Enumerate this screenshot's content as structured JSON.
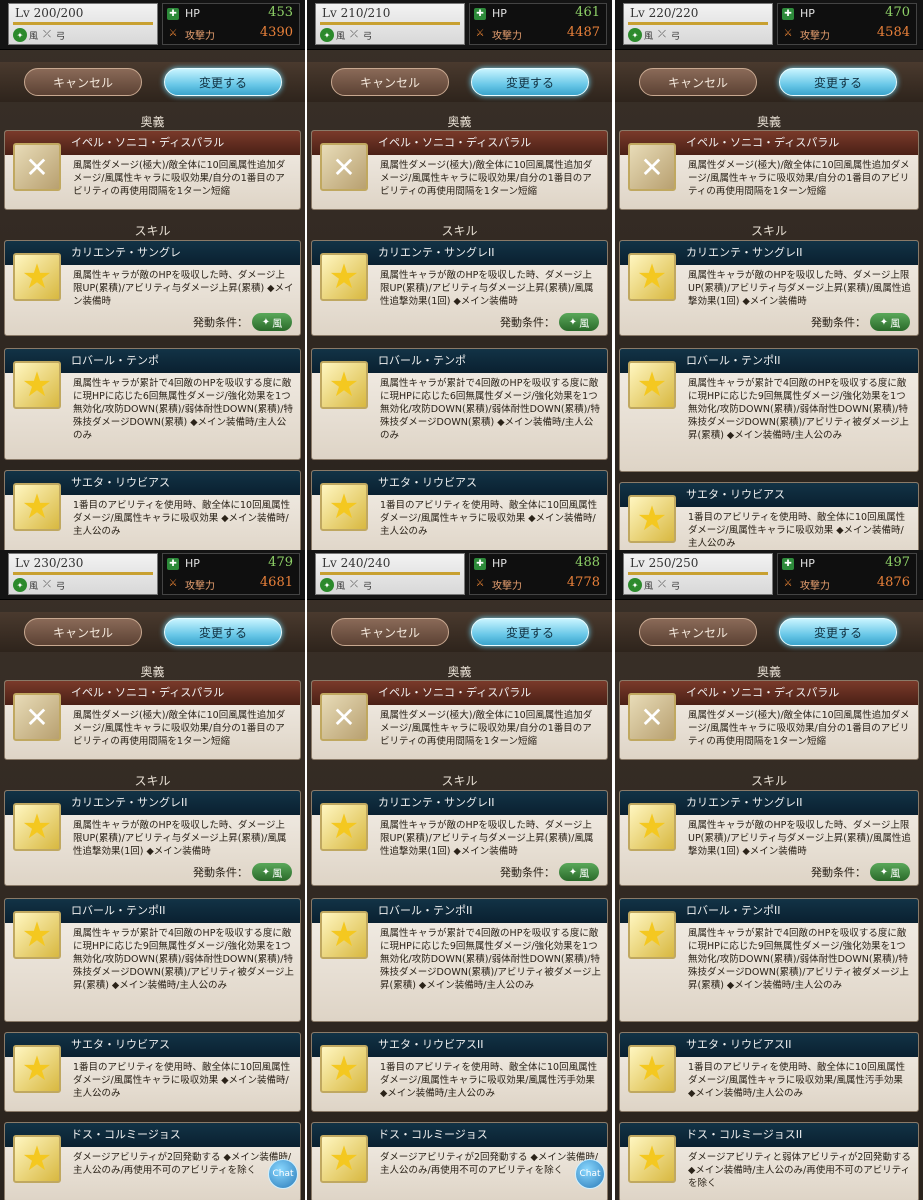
{
  "ui": {
    "cancel_label": "キャンセル",
    "change_label": "変更する",
    "ougi_section": "奥義",
    "skill_section": "スキル",
    "hp_label": "HP",
    "atk_label": "攻撃力",
    "elem_label": "風",
    "weapon_label": "弓",
    "cond_label": "発動条件：",
    "cond_elem": "風",
    "chat_label": "Chat"
  },
  "panels": [
    {
      "lv": "Lv 200/200",
      "hp": "453",
      "atk": "4390",
      "ougi": {
        "name": "イペル・ソニコ・ディスパラル",
        "desc": "風属性ダメージ(極大)/敵全体に10回風属性追加ダメージ/風属性キャラに吸収効果/自分の1番目のアビリティの再使用間隔を1ターン短縮"
      },
      "skills": [
        {
          "name": "カリエンテ・サングレ",
          "desc": "風属性キャラが敵のHPを吸収した時、ダメージ上限UP(累積)/アビリティ与ダメージ上昇(累積) ◆メイン装備時"
        },
        {
          "name": "ロバール・テンポ",
          "desc": "風属性キャラが累計で4回敵のHPを吸収する度に敵に現HPに応じた6回無属性ダメージ/強化効果を1つ無効化/攻防DOWN(累積)/弱体耐性DOWN(累積)/特殊技ダメージDOWN(累積) ◆メイン装備時/主人公のみ"
        },
        {
          "name": "サエタ・リウビアス",
          "desc": "1番目のアビリティを使用時、敵全体に10回風属性ダメージ/風属性キャラに吸収効果 ◆メイン装備時/主人公のみ"
        }
      ]
    },
    {
      "lv": "Lv 210/210",
      "hp": "461",
      "atk": "4487",
      "ougi": {
        "name": "イペル・ソニコ・ディスパラル",
        "desc": "風属性ダメージ(極大)/敵全体に10回風属性追加ダメージ/風属性キャラに吸収効果/自分の1番目のアビリティの再使用間隔を1ターン短縮"
      },
      "skills": [
        {
          "name": "カリエンテ・サングレII",
          "desc": "風属性キャラが敵のHPを吸収した時、ダメージ上限UP(累積)/アビリティ与ダメージ上昇(累積)/風属性追撃効果(1回) ◆メイン装備時"
        },
        {
          "name": "ロバール・テンポ",
          "desc": "風属性キャラが累計で4回敵のHPを吸収する度に敵に現HPに応じた6回無属性ダメージ/強化効果を1つ無効化/攻防DOWN(累積)/弱体耐性DOWN(累積)/特殊技ダメージDOWN(累積) ◆メイン装備時/主人公のみ"
        },
        {
          "name": "サエタ・リウビアス",
          "desc": "1番目のアビリティを使用時、敵全体に10回風属性ダメージ/風属性キャラに吸収効果 ◆メイン装備時/主人公のみ"
        }
      ]
    },
    {
      "lv": "Lv 220/220",
      "hp": "470",
      "atk": "4584",
      "ougi": {
        "name": "イペル・ソニコ・ディスパラル",
        "desc": "風属性ダメージ(極大)/敵全体に10回風属性追加ダメージ/風属性キャラに吸収効果/自分の1番目のアビリティの再使用間隔を1ターン短縮"
      },
      "skills": [
        {
          "name": "カリエンテ・サングレII",
          "desc": "風属性キャラが敵のHPを吸収した時、ダメージ上限UP(累積)/アビリティ与ダメージ上昇(累積)/風属性追撃効果(1回) ◆メイン装備時"
        },
        {
          "name": "ロバール・テンポII",
          "desc": "風属性キャラが累計で4回敵のHPを吸収する度に敵に現HPに応じた9回無属性ダメージ/強化効果を1つ無効化/攻防DOWN(累積)/弱体耐性DOWN(累積)/特殊技ダメージDOWN(累積)/アビリティ被ダメージ上昇(累積) ◆メイン装備時/主人公のみ"
        },
        {
          "name": "サエタ・リウビアス",
          "desc": "1番目のアビリティを使用時、敵全体に10回風属性ダメージ/風属性キャラに吸収効果 ◆メイン装備時/主人公のみ"
        }
      ]
    },
    {
      "lv": "Lv 230/230",
      "hp": "479",
      "atk": "4681",
      "ougi": {
        "name": "イペル・ソニコ・ディスパラル",
        "desc": "風属性ダメージ(極大)/敵全体に10回風属性追加ダメージ/風属性キャラに吸収効果/自分の1番目のアビリティの再使用間隔を1ターン短縮"
      },
      "skills": [
        {
          "name": "カリエンテ・サングレII",
          "desc": "風属性キャラが敵のHPを吸収した時、ダメージ上限UP(累積)/アビリティ与ダメージ上昇(累積)/風属性追撃効果(1回) ◆メイン装備時"
        },
        {
          "name": "ロバール・テンポII",
          "desc": "風属性キャラが累計で4回敵のHPを吸収する度に敵に現HPに応じた9回無属性ダメージ/強化効果を1つ無効化/攻防DOWN(累積)/弱体耐性DOWN(累積)/特殊技ダメージDOWN(累積)/アビリティ被ダメージ上昇(累積) ◆メイン装備時/主人公のみ"
        },
        {
          "name": "サエタ・リウビアス",
          "desc": "1番目のアビリティを使用時、敵全体に10回風属性ダメージ/風属性キャラに吸収効果 ◆メイン装備時/主人公のみ"
        },
        {
          "name": "ドス・コルミージョス",
          "desc": "ダメージアビリティが2回発動する ◆メイン装備時/主人公のみ/再使用不可のアビリティを除く"
        }
      ]
    },
    {
      "lv": "Lv 240/240",
      "hp": "488",
      "atk": "4778",
      "ougi": {
        "name": "イペル・ソニコ・ディスパラル",
        "desc": "風属性ダメージ(極大)/敵全体に10回風属性追加ダメージ/風属性キャラに吸収効果/自分の1番目のアビリティの再使用間隔を1ターン短縮"
      },
      "skills": [
        {
          "name": "カリエンテ・サングレII",
          "desc": "風属性キャラが敵のHPを吸収した時、ダメージ上限UP(累積)/アビリティ与ダメージ上昇(累積)/風属性追撃効果(1回) ◆メイン装備時"
        },
        {
          "name": "ロバール・テンポII",
          "desc": "風属性キャラが累計で4回敵のHPを吸収する度に敵に現HPに応じた9回無属性ダメージ/強化効果を1つ無効化/攻防DOWN(累積)/弱体耐性DOWN(累積)/特殊技ダメージDOWN(累積)/アビリティ被ダメージ上昇(累積) ◆メイン装備時/主人公のみ"
        },
        {
          "name": "サエタ・リウビアスII",
          "desc": "1番目のアビリティを使用時、敵全体に10回風属性ダメージ/風属性キャラに吸収効果/風属性汚手効果 ◆メイン装備時/主人公のみ"
        },
        {
          "name": "ドス・コルミージョス",
          "desc": "ダメージアビリティが2回発動する ◆メイン装備時/主人公のみ/再使用不可のアビリティを除く"
        }
      ]
    },
    {
      "lv": "Lv 250/250",
      "hp": "497",
      "atk": "4876",
      "ougi": {
        "name": "イペル・ソニコ・ディスパラル",
        "desc": "風属性ダメージ(極大)/敵全体に10回風属性追加ダメージ/風属性キャラに吸収効果/自分の1番目のアビリティの再使用間隔を1ターン短縮"
      },
      "skills": [
        {
          "name": "カリエンテ・サングレII",
          "desc": "風属性キャラが敵のHPを吸収した時、ダメージ上限UP(累積)/アビリティ与ダメージ上昇(累積)/風属性追撃効果(1回) ◆メイン装備時"
        },
        {
          "name": "ロバール・テンポII",
          "desc": "風属性キャラが累計で4回敵のHPを吸収する度に敵に現HPに応じた9回無属性ダメージ/強化効果を1つ無効化/攻防DOWN(累積)/弱体耐性DOWN(累積)/特殊技ダメージDOWN(累積)/アビリティ被ダメージ上昇(累積) ◆メイン装備時/主人公のみ"
        },
        {
          "name": "サエタ・リウビアスII",
          "desc": "1番目のアビリティを使用時、敵全体に10回風属性ダメージ/風属性キャラに吸収効果/風属性汚手効果 ◆メイン装備時/主人公のみ"
        },
        {
          "name": "ドス・コルミージョスII",
          "desc": "ダメージアビリティと弱体アビリティが2回発動する ◆メイン装備時/主人公のみ/再使用不可のアビリティを除く"
        }
      ]
    }
  ]
}
